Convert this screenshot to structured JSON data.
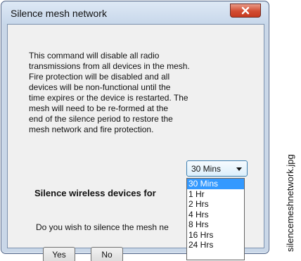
{
  "window": {
    "title": "Silence mesh network",
    "close_label": "X",
    "message_lines": [
      "This command will disable all radio",
      "transmissions from all devices in the mesh.",
      "Fire protection will be disabled and all",
      "devices will be non-functional until the",
      "time expires or the device is restarted. The",
      "mesh will need to be re-formed at the",
      "end of the silence period to restore the",
      "mesh network and fire protection."
    ],
    "silence_label": "Silence wireless devices for",
    "combo_value": "30 Mins",
    "question": "Do you wish to silence the mesh ne",
    "yes_label": "Yes",
    "no_label": "No"
  },
  "dropdown": {
    "options": [
      "30 Mins",
      "1 Hr",
      "2 Hrs",
      "4 Hrs",
      "8 Hrs",
      "16 Hrs",
      "24 Hrs"
    ]
  },
  "caption": "silencemeshnetwork.jpg",
  "colors": {
    "selected_item": "#3399ff",
    "close_button": "#d24c31",
    "client_bg": "#f0f0f0"
  }
}
